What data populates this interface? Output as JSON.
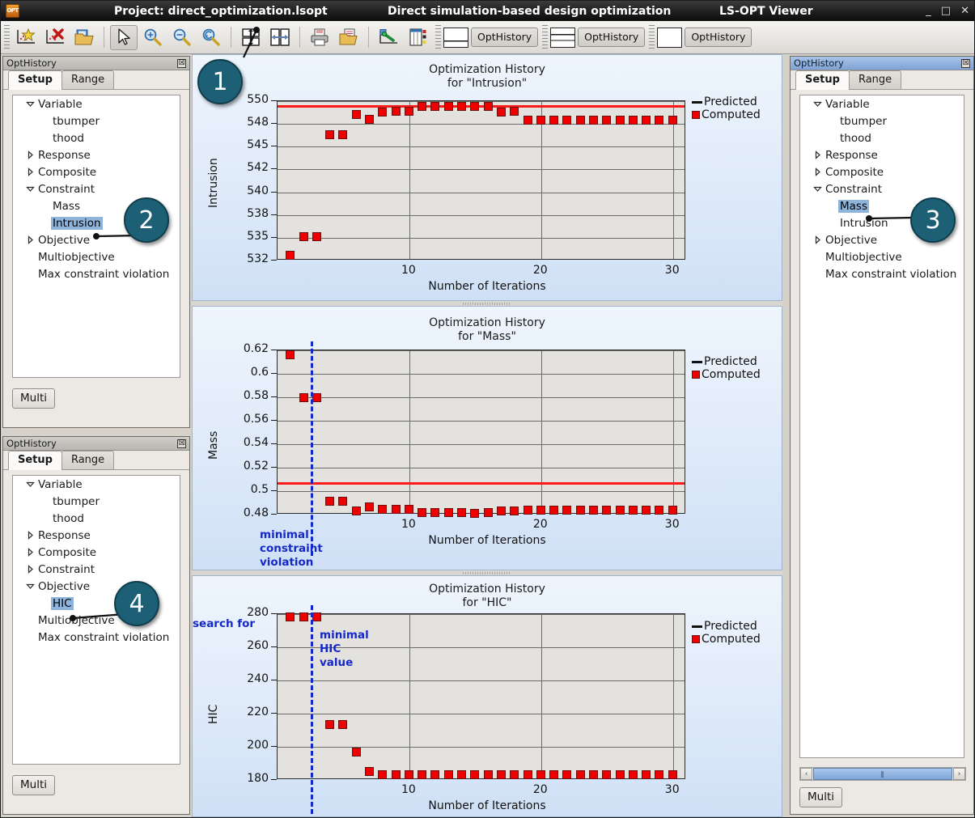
{
  "titlebar": {
    "app_icon": "lsopt-app-icon",
    "project": "Project: direct_optimization.lsopt",
    "subtitle": "Direct simulation-based design optimization",
    "app": "LS-OPT Viewer",
    "minimize": "_",
    "maximize": "□",
    "close": "✕"
  },
  "toolbar": {
    "buttons": [
      {
        "name": "new-plot-icon",
        "glyph": "☆"
      },
      {
        "name": "delete-plot-icon",
        "glyph": "✕"
      },
      {
        "name": "open-folder-icon",
        "glyph": "📁"
      },
      {
        "name": "pointer-icon",
        "glyph": "➤"
      },
      {
        "name": "zoom-in-icon",
        "glyph": "+"
      },
      {
        "name": "zoom-out-icon",
        "glyph": "−"
      },
      {
        "name": "zoom-reset-icon",
        "glyph": "↺"
      },
      {
        "name": "split-horizontal-icon",
        "glyph": "↕"
      },
      {
        "name": "split-vertical-icon",
        "glyph": "↔"
      },
      {
        "name": "print-icon",
        "glyph": "⎙"
      },
      {
        "name": "save-as-icon",
        "glyph": "📂"
      },
      {
        "name": "curve-tool-icon",
        "glyph": "↗"
      },
      {
        "name": "table-tool-icon",
        "glyph": "▤"
      }
    ],
    "views": [
      {
        "name": "layout-split-bottom",
        "label": "OptHistory"
      },
      {
        "name": "layout-three-rows",
        "label": "OptHistory"
      },
      {
        "name": "layout-single",
        "label": "OptHistory"
      }
    ]
  },
  "panels": {
    "left_top": {
      "title": "OptHistory",
      "close": "☒",
      "tabs": [
        {
          "label": "Setup",
          "selected": true
        },
        {
          "label": "Range",
          "selected": false
        }
      ],
      "tree": [
        {
          "twisty": "down",
          "label": "Variable",
          "indent": 0,
          "selected": false
        },
        {
          "twisty": "none",
          "label": "tbumper",
          "indent": 1,
          "selected": false
        },
        {
          "twisty": "none",
          "label": "thood",
          "indent": 1,
          "selected": false
        },
        {
          "twisty": "right",
          "label": "Response",
          "indent": 0,
          "selected": false
        },
        {
          "twisty": "right",
          "label": "Composite",
          "indent": 0,
          "selected": false
        },
        {
          "twisty": "down",
          "label": "Constraint",
          "indent": 0,
          "selected": false
        },
        {
          "twisty": "none",
          "label": "Mass",
          "indent": 1,
          "selected": false
        },
        {
          "twisty": "none",
          "label": "Intrusion",
          "indent": 1,
          "selected": true
        },
        {
          "twisty": "right",
          "label": "Objective",
          "indent": 0,
          "selected": false
        },
        {
          "twisty": "none",
          "label": "Multiobjective",
          "indent": 0,
          "selected": false
        },
        {
          "twisty": "none",
          "label": "Max constraint violation",
          "indent": 0,
          "selected": false
        }
      ],
      "multi_button": "Multi"
    },
    "left_bottom": {
      "title": "OptHistory",
      "close": "☒",
      "tabs": [
        {
          "label": "Setup",
          "selected": true
        },
        {
          "label": "Range",
          "selected": false
        }
      ],
      "tree": [
        {
          "twisty": "down",
          "label": "Variable",
          "indent": 0,
          "selected": false
        },
        {
          "twisty": "none",
          "label": "tbumper",
          "indent": 1,
          "selected": false
        },
        {
          "twisty": "none",
          "label": "thood",
          "indent": 1,
          "selected": false
        },
        {
          "twisty": "right",
          "label": "Response",
          "indent": 0,
          "selected": false
        },
        {
          "twisty": "right",
          "label": "Composite",
          "indent": 0,
          "selected": false
        },
        {
          "twisty": "right",
          "label": "Constraint",
          "indent": 0,
          "selected": false
        },
        {
          "twisty": "down",
          "label": "Objective",
          "indent": 0,
          "selected": false
        },
        {
          "twisty": "none",
          "label": "HIC",
          "indent": 1,
          "selected": true
        },
        {
          "twisty": "none",
          "label": "Multiobjective",
          "indent": 0,
          "selected": false
        },
        {
          "twisty": "none",
          "label": "Max constraint violation",
          "indent": 0,
          "selected": false
        }
      ],
      "multi_button": "Multi"
    },
    "right": {
      "title": "OptHistory",
      "close": "☒",
      "tabs": [
        {
          "label": "Setup",
          "selected": true
        },
        {
          "label": "Range",
          "selected": false
        }
      ],
      "tree": [
        {
          "twisty": "down",
          "label": "Variable",
          "indent": 0,
          "selected": false
        },
        {
          "twisty": "none",
          "label": "tbumper",
          "indent": 1,
          "selected": false
        },
        {
          "twisty": "none",
          "label": "thood",
          "indent": 1,
          "selected": false
        },
        {
          "twisty": "right",
          "label": "Response",
          "indent": 0,
          "selected": false
        },
        {
          "twisty": "right",
          "label": "Composite",
          "indent": 0,
          "selected": false
        },
        {
          "twisty": "down",
          "label": "Constraint",
          "indent": 0,
          "selected": false
        },
        {
          "twisty": "none",
          "label": "Mass",
          "indent": 1,
          "selected": true
        },
        {
          "twisty": "none",
          "label": "Intrusion",
          "indent": 1,
          "selected": false
        },
        {
          "twisty": "right",
          "label": "Objective",
          "indent": 0,
          "selected": false
        },
        {
          "twisty": "none",
          "label": "Multiobjective",
          "indent": 0,
          "selected": false
        },
        {
          "twisty": "none",
          "label": "Max constraint violation",
          "indent": 0,
          "selected": false
        }
      ],
      "scrollbar": {
        "left_arrow": "‹",
        "right_arrow": "›",
        "thumb": "‖"
      },
      "multi_button": "Multi"
    }
  },
  "callouts": [
    {
      "number": "1",
      "target": "split-horizontal-toolbar-button"
    },
    {
      "number": "2",
      "target": "tree-item-intrusion"
    },
    {
      "number": "3",
      "target": "tree-item-mass"
    },
    {
      "number": "4",
      "target": "tree-item-hic"
    }
  ],
  "annotations": [
    {
      "name": "annotation-minimal-constraint-violation",
      "text": "minimal\nconstraint\nviolation"
    },
    {
      "name": "annotation-search-for",
      "text": "search for"
    },
    {
      "name": "annotation-minimal-hic-value",
      "text": "minimal\nHIC\nvalue"
    }
  ],
  "chart_data": [
    {
      "type": "scatter",
      "name": "intrusion-chart",
      "title": "Optimization History",
      "subtitle": "for \"Intrusion\"",
      "xlabel": "Number of Iterations",
      "ylabel": "Intrusion",
      "xlim": [
        0,
        31
      ],
      "ylim": [
        531.5,
        550.6
      ],
      "xticks": [
        10,
        20,
        30
      ],
      "yticks": [
        532,
        535,
        538,
        540,
        542,
        545,
        548,
        550
      ],
      "grid": true,
      "legend": [
        {
          "name": "Predicted",
          "symbol": "line",
          "color": "#111111"
        },
        {
          "name": "Computed",
          "symbol": "square",
          "color": "#ee0000"
        }
      ],
      "constraint_line": {
        "value": 550,
        "color": "#ff1a1a",
        "label": "Predicted"
      },
      "x": [
        1,
        2,
        3,
        4,
        5,
        6,
        7,
        8,
        9,
        10,
        11,
        12,
        13,
        14,
        15,
        16,
        17,
        18,
        19,
        20,
        21,
        22,
        23,
        24,
        25,
        26,
        27,
        28,
        29,
        30
      ],
      "values": [
        532.1,
        534.3,
        534.3,
        546.5,
        546.5,
        549.0,
        548.4,
        549.2,
        549.3,
        549.3,
        549.9,
        549.9,
        549.9,
        549.9,
        549.9,
        549.9,
        549.2,
        549.3,
        548.3,
        548.3,
        548.3,
        548.3,
        548.3,
        548.3,
        548.3,
        548.3,
        548.3,
        548.3,
        548.3,
        548.3
      ]
    },
    {
      "type": "scatter",
      "name": "mass-chart",
      "title": "Optimization History",
      "subtitle": "for \"Mass\"",
      "xlabel": "Number of Iterations",
      "ylabel": "Mass",
      "xlim": [
        0,
        31
      ],
      "ylim": [
        0.468,
        0.633
      ],
      "xticks": [
        10,
        20,
        30
      ],
      "yticks": [
        0.48,
        0.5,
        0.52,
        0.54,
        0.56,
        0.58,
        0.6,
        0.62
      ],
      "grid": true,
      "legend": [
        {
          "name": "Predicted",
          "symbol": "line",
          "color": "#111111"
        },
        {
          "name": "Computed",
          "symbol": "square",
          "color": "#ee0000"
        }
      ],
      "constraint_line": {
        "value": 0.5,
        "color": "#ff1a1a",
        "label": "Predicted"
      },
      "marker_line": {
        "value": 2.6,
        "color": "#1528c8",
        "style": "dashed",
        "label": "minimal constraint violation"
      },
      "x": [
        1,
        2,
        3,
        4,
        5,
        6,
        7,
        8,
        9,
        10,
        11,
        12,
        13,
        14,
        15,
        16,
        17,
        18,
        19,
        20,
        21,
        22,
        23,
        24,
        25,
        26,
        27,
        28,
        29,
        30
      ],
      "values": [
        0.628,
        0.585,
        0.585,
        0.481,
        0.481,
        0.4715,
        0.4755,
        0.4725,
        0.4725,
        0.4725,
        0.4695,
        0.47,
        0.47,
        0.4695,
        0.469,
        0.4695,
        0.4715,
        0.471,
        0.472,
        0.4722,
        0.4722,
        0.4722,
        0.4722,
        0.4722,
        0.4722,
        0.4722,
        0.4722,
        0.4722,
        0.4722,
        0.4722
      ]
    },
    {
      "type": "scatter",
      "name": "hic-chart",
      "title": "Optimization History",
      "subtitle": "for \"HIC\"",
      "xlabel": "Number of Iterations",
      "ylabel": "HIC",
      "xlim": [
        0,
        31
      ],
      "ylim": [
        173,
        282
      ],
      "xticks": [
        10,
        20,
        30
      ],
      "yticks": [
        180,
        200,
        220,
        240,
        260,
        280
      ],
      "grid": true,
      "legend": [
        {
          "name": "Predicted",
          "symbol": "line",
          "color": "#111111"
        },
        {
          "name": "Computed",
          "symbol": "square",
          "color": "#ee0000"
        }
      ],
      "marker_line": {
        "value": 2.6,
        "color": "#1528c8",
        "style": "dashed",
        "label": "minimal HIC value"
      },
      "x": [
        1,
        2,
        3,
        4,
        5,
        6,
        7,
        8,
        9,
        10,
        11,
        12,
        13,
        14,
        15,
        16,
        17,
        18,
        19,
        20,
        21,
        22,
        23,
        24,
        25,
        26,
        27,
        28,
        29,
        30
      ],
      "values": [
        280,
        280,
        280,
        209,
        209,
        191,
        178.5,
        176,
        176,
        176,
        176,
        176,
        176,
        176,
        176,
        176,
        176,
        176,
        176,
        176,
        176,
        176,
        176,
        176,
        176,
        176,
        176,
        176,
        176,
        176
      ]
    }
  ]
}
